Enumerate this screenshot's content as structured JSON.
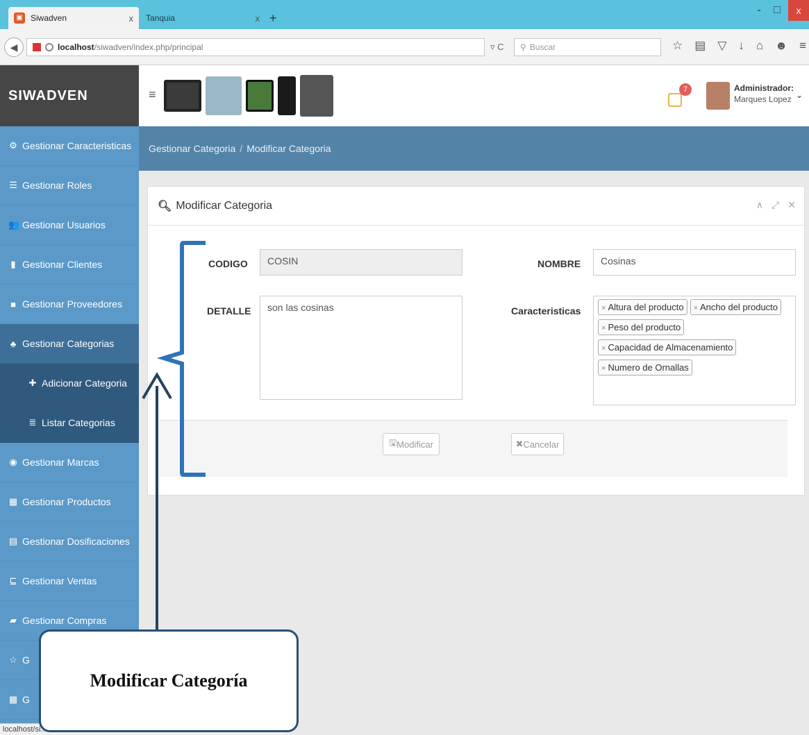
{
  "browser": {
    "tabs": [
      {
        "title": "Siwadven",
        "close": "x"
      },
      {
        "title": "Tanquia",
        "close": "x"
      }
    ],
    "new_tab": "+",
    "window_controls": {
      "minimize": "-",
      "maximize": "□",
      "close": "x"
    },
    "url_host": "localhost",
    "url_path": "/siwadven/index.php/principal",
    "search_placeholder": "Buscar",
    "status_text": "localhost/si..."
  },
  "app": {
    "brand": "SIWADVEN",
    "user": {
      "role": "Administrador:",
      "name": "Marques Lopez"
    },
    "notification_count": "7"
  },
  "sidebar": {
    "items": [
      {
        "label": "Gestionar Caracteristicas",
        "icon": "cogs-icon",
        "glyph": "⚙"
      },
      {
        "label": "Gestionar Roles",
        "icon": "list-icon",
        "glyph": "☰"
      },
      {
        "label": "Gestionar Usuarios",
        "icon": "users-icon",
        "glyph": "👥"
      },
      {
        "label": "Gestionar Clientes",
        "icon": "briefcase-icon",
        "glyph": "▮"
      },
      {
        "label": "Gestionar Proveedores",
        "icon": "truck-icon",
        "glyph": "■"
      },
      {
        "label": "Gestionar Categorias",
        "icon": "sitemap-icon",
        "glyph": "♣"
      },
      {
        "label": "Adicionar Categoria",
        "icon": "plus-icon",
        "glyph": "✚"
      },
      {
        "label": "Listar Categorias",
        "icon": "list-icon",
        "glyph": "≣"
      },
      {
        "label": "Gestionar Marcas",
        "icon": "target-icon",
        "glyph": "◉"
      },
      {
        "label": "Gestionar Productos",
        "icon": "calendar-icon",
        "glyph": "▦"
      },
      {
        "label": "Gestionar Dosificaciones",
        "icon": "doc-icon",
        "glyph": "▤"
      },
      {
        "label": "Gestionar Ventas",
        "icon": "cart-icon",
        "glyph": "⊑"
      },
      {
        "label": "Gestionar Compras",
        "icon": "book-icon",
        "glyph": "▰"
      },
      {
        "label": "G",
        "icon": "star-icon",
        "glyph": "☆"
      },
      {
        "label": "G",
        "icon": "table-icon",
        "glyph": "▦"
      }
    ]
  },
  "breadcrumb": {
    "root": "Gestionar Categoria",
    "separator": "/",
    "current": "Modificar Categoria"
  },
  "form": {
    "title": "Modificar Categoria",
    "codigo_label": "CODIGO",
    "codigo_value": "COSIN",
    "nombre_label": "NOMBRE",
    "nombre_value": "Cosinas",
    "detalle_label": "DETALLE",
    "detalle_value": "son las cosinas",
    "caracteristicas_label": "Caracteristicas",
    "tags": [
      "Altura del producto",
      "Ancho del producto",
      "Peso del producto",
      "Capacidad de Almacenamiento",
      "Numero de Ornallas"
    ],
    "modificar_button": "Modificar",
    "cancelar_button": "Cancelar"
  },
  "annotation": {
    "callout_text": "Modificar Categoría"
  }
}
